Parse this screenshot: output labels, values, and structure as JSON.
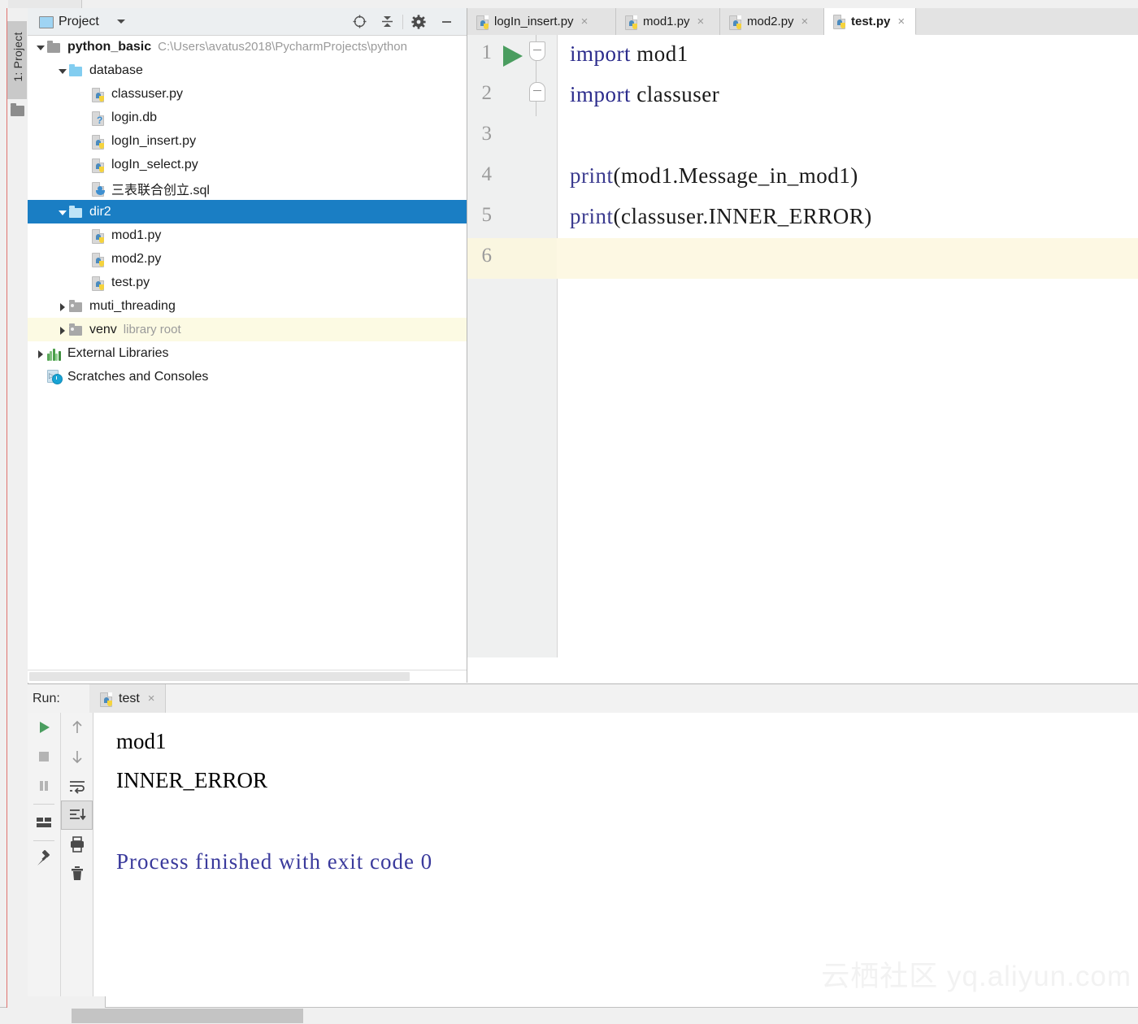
{
  "app": {
    "title": "PyCharm",
    "watermark": "云栖社区 yq.aliyun.com"
  },
  "left_strip": {
    "tool_tab": "1: Project",
    "folder_icon": "folder-icon"
  },
  "project_panel": {
    "title": "Project",
    "caret": "chevron-down-icon",
    "header_icons": [
      {
        "name": "locate-target-icon",
        "glyph": "⊕"
      },
      {
        "name": "collapse-all-icon",
        "glyph": "⇕"
      },
      {
        "name": "gear-icon",
        "glyph": "✲"
      },
      {
        "name": "minimize-icon",
        "glyph": "—"
      }
    ],
    "tree": [
      {
        "indent": 0,
        "arrow": "open",
        "icon": "folder-gray",
        "label": "python_basic",
        "bold": true,
        "sub": "C:\\Users\\avatus2018\\PycharmProjects\\python",
        "state": "normal"
      },
      {
        "indent": 1,
        "arrow": "open",
        "icon": "folder-blue",
        "label": "database",
        "bold": false,
        "sub": "",
        "state": "normal"
      },
      {
        "indent": 2,
        "arrow": "none",
        "icon": "py-file",
        "label": "classuser.py",
        "bold": false,
        "sub": "",
        "state": "normal"
      },
      {
        "indent": 2,
        "arrow": "none",
        "icon": "db-file",
        "label": "login.db",
        "bold": false,
        "sub": "",
        "state": "normal"
      },
      {
        "indent": 2,
        "arrow": "none",
        "icon": "py-file",
        "label": "logIn_insert.py",
        "bold": false,
        "sub": "",
        "state": "normal"
      },
      {
        "indent": 2,
        "arrow": "none",
        "icon": "py-file",
        "label": "logIn_select.py",
        "bold": false,
        "sub": "",
        "state": "normal"
      },
      {
        "indent": 2,
        "arrow": "none",
        "icon": "sql-file",
        "label": "三表联合创立.sql",
        "bold": false,
        "sub": "",
        "state": "normal"
      },
      {
        "indent": 1,
        "arrow": "open",
        "icon": "folder-blue",
        "label": "dir2",
        "bold": false,
        "sub": "",
        "state": "selected"
      },
      {
        "indent": 2,
        "arrow": "none",
        "icon": "py-file",
        "label": "mod1.py",
        "bold": false,
        "sub": "",
        "state": "normal"
      },
      {
        "indent": 2,
        "arrow": "none",
        "icon": "py-file",
        "label": "mod2.py",
        "bold": false,
        "sub": "",
        "state": "normal"
      },
      {
        "indent": 2,
        "arrow": "none",
        "icon": "py-file",
        "label": "test.py",
        "bold": false,
        "sub": "",
        "state": "normal"
      },
      {
        "indent": 1,
        "arrow": "closed",
        "icon": "folder-lib",
        "label": "muti_threading",
        "bold": false,
        "sub": "",
        "state": "normal"
      },
      {
        "indent": 1,
        "arrow": "closed",
        "icon": "folder-lib",
        "label": "venv",
        "bold": false,
        "sub": "library root",
        "state": "highlight"
      },
      {
        "indent": 0,
        "arrow": "closed",
        "icon": "ext-lib",
        "label": "External Libraries",
        "bold": false,
        "sub": "",
        "state": "normal"
      },
      {
        "indent": 0,
        "arrow": "none",
        "icon": "scratch",
        "label": "Scratches and Consoles",
        "bold": false,
        "sub": "",
        "state": "normal"
      }
    ]
  },
  "editor": {
    "tabs": [
      {
        "label": "logIn_insert.py",
        "active": false,
        "close": "×"
      },
      {
        "label": "mod1.py",
        "active": false,
        "close": "×"
      },
      {
        "label": "mod2.py",
        "active": false,
        "close": "×"
      },
      {
        "label": "test.py",
        "active": true,
        "close": "×"
      }
    ],
    "lines": [
      {
        "num": "1",
        "segments": [
          {
            "t": "import",
            "c": "kw"
          },
          {
            "t": " mod1",
            "c": ""
          }
        ],
        "caret": false
      },
      {
        "num": "2",
        "segments": [
          {
            "t": "import",
            "c": "kw"
          },
          {
            "t": " classuser",
            "c": ""
          }
        ],
        "caret": false
      },
      {
        "num": "3",
        "segments": [],
        "caret": false
      },
      {
        "num": "4",
        "segments": [
          {
            "t": "print",
            "c": "fn"
          },
          {
            "t": "(mod1.Message_in_mod1)",
            "c": ""
          }
        ],
        "caret": false
      },
      {
        "num": "5",
        "segments": [
          {
            "t": "print",
            "c": "fn"
          },
          {
            "t": "(classuser.INNER_ERROR)",
            "c": ""
          }
        ],
        "caret": false
      },
      {
        "num": "6",
        "segments": [],
        "caret": true
      }
    ],
    "gutter": {
      "run_marker": "run-gutter-icon",
      "fold_1": "fold-collapse-icon",
      "fold_2": "fold-collapse-icon"
    }
  },
  "run_panel": {
    "label": "Run:",
    "tab": {
      "label": "test",
      "close": "×"
    },
    "tools_left": [
      {
        "name": "rerun-button",
        "glyph": "▶",
        "active": false
      },
      {
        "name": "stop-button",
        "glyph": "■",
        "active": false
      },
      {
        "name": "pause-button",
        "glyph": "❚❚",
        "active": false
      },
      {
        "name": "layout-button",
        "glyph": "▤",
        "active": false
      },
      {
        "name": "pin-tab-button",
        "glyph": "📌",
        "active": false
      }
    ],
    "tools_right": [
      {
        "name": "up-arrow-button",
        "glyph": "↑",
        "active": false
      },
      {
        "name": "down-arrow-button",
        "glyph": "↓",
        "active": false
      },
      {
        "name": "soft-wrap-button",
        "glyph": "⤸",
        "active": false
      },
      {
        "name": "scroll-to-end-button",
        "glyph": "⤓",
        "active": true
      },
      {
        "name": "print-button",
        "glyph": "🖶",
        "active": false
      },
      {
        "name": "clear-all-button",
        "glyph": "🗑",
        "active": false
      }
    ],
    "output": [
      {
        "text": "mod1",
        "color": "black"
      },
      {
        "text": "INNER_ERROR",
        "color": "black"
      },
      {
        "text": "Process finished with exit code 0",
        "color": "blue"
      }
    ]
  }
}
